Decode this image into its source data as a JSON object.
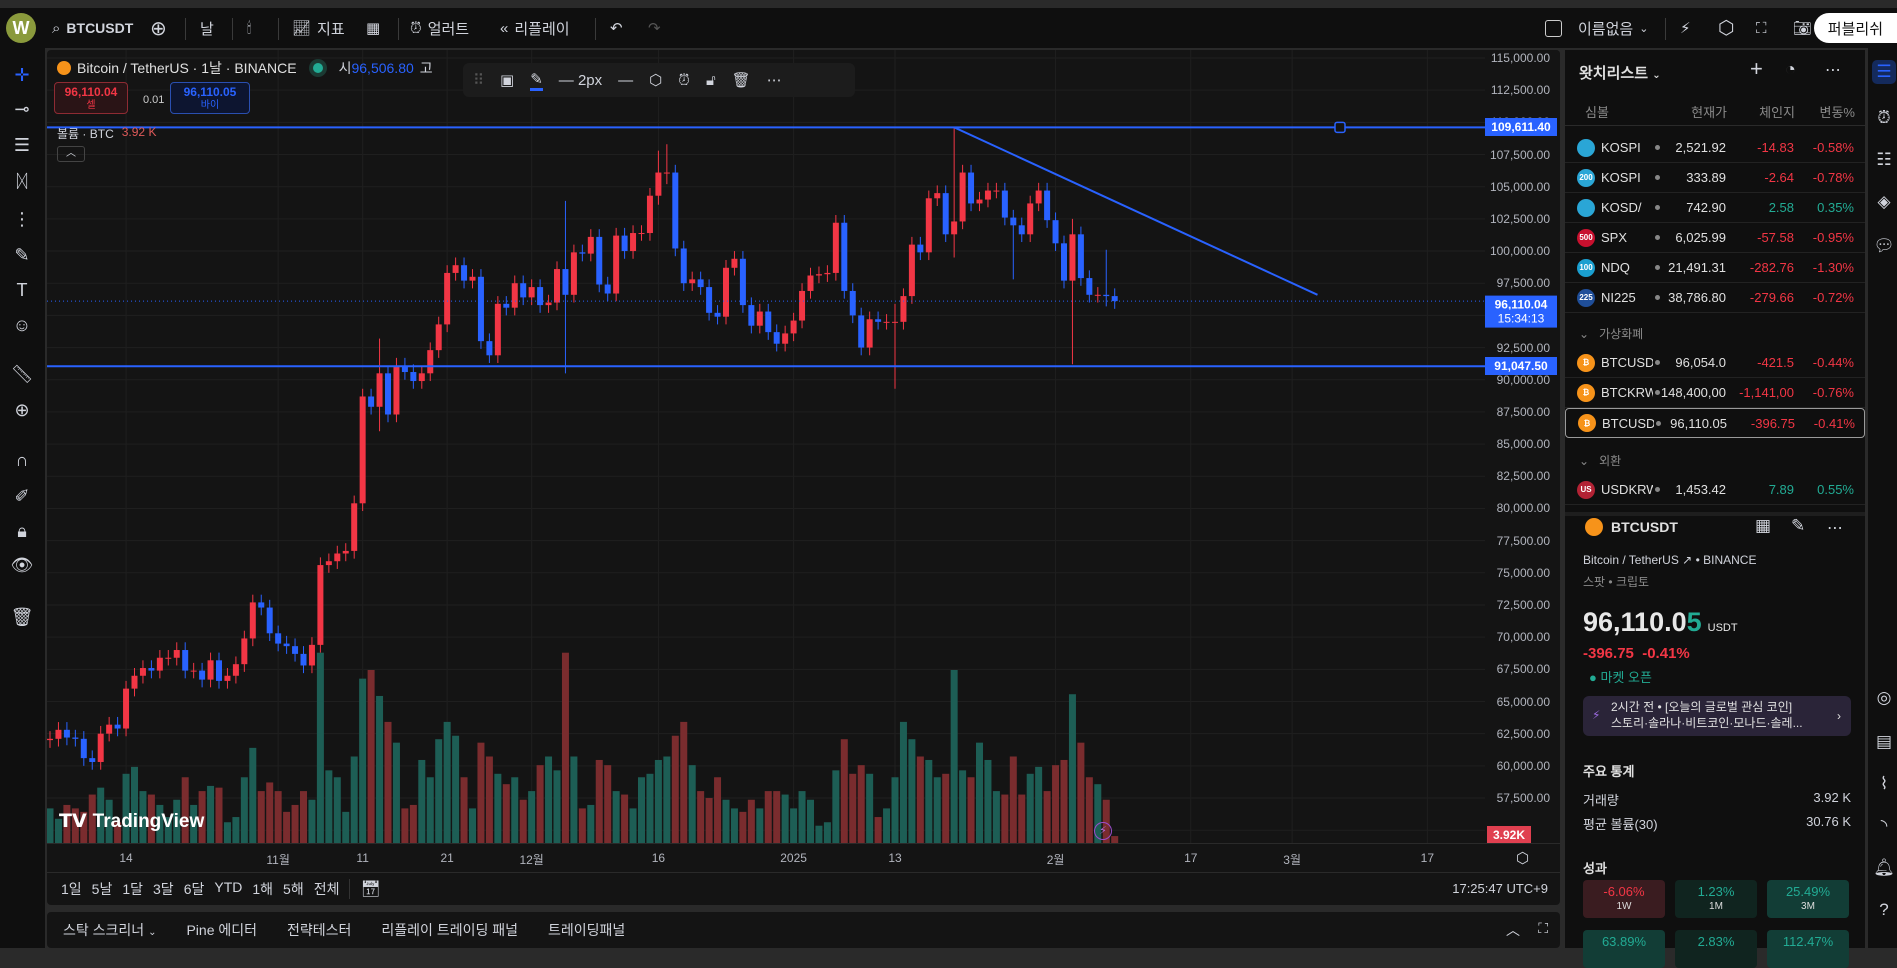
{
  "topbar": {
    "avatar": "W",
    "symbol": "BTCUSDT",
    "interval": "날",
    "indicators": "지표",
    "alert": "얼러트",
    "replay": "리플레이",
    "layout_name": "이름없음",
    "publish": "퍼블리쉬"
  },
  "legend": {
    "title": "Bitcoin / TetherUS · 1날 · BINANCE",
    "open_label": "시",
    "open_value": "96,506.80",
    "high_label": "고",
    "sell_price": "96,110.04",
    "sell_label": "셀",
    "spread": "0.01",
    "buy_price": "96,110.05",
    "buy_label": "바이",
    "volume_label": "볼륨 · BTC",
    "volume_value": "3.92 K"
  },
  "drawing_toolbar": {
    "width_label": "2px"
  },
  "price_axis": {
    "ticks": [
      "115,000.00",
      "112,500.00",
      "110,000.00",
      "107,500.00",
      "105,000.00",
      "102,500.00",
      "100,000.00",
      "97,500.00",
      "95,000.00",
      "92,500.00",
      "90,000.00",
      "87,500.00",
      "85,000.00",
      "82,500.00",
      "80,000.00",
      "77,500.00",
      "75,000.00",
      "72,500.00",
      "70,000.00",
      "67,500.00",
      "65,000.00",
      "62,500.00",
      "60,000.00",
      "57,500.00"
    ],
    "resistance_label": "109,611.40",
    "support_label": "91,047.50",
    "last_price_label": "96,110.04",
    "countdown": "15:34:13",
    "volume_badge": "3.92K"
  },
  "time_axis": {
    "labels": [
      {
        "text": "14",
        "index": 9
      },
      {
        "text": "11월",
        "index": 27
      },
      {
        "text": "11",
        "index": 37
      },
      {
        "text": "21",
        "index": 47
      },
      {
        "text": "12월",
        "index": 57
      },
      {
        "text": "16",
        "index": 72
      },
      {
        "text": "2025",
        "index": 88
      },
      {
        "text": "13",
        "index": 100
      },
      {
        "text": "2월",
        "index": 119
      },
      {
        "text": "17",
        "index": 135
      },
      {
        "text": "3월",
        "index": 147
      },
      {
        "text": "17",
        "index": 163
      }
    ]
  },
  "range_bar": {
    "ranges": [
      "1일",
      "5날",
      "1달",
      "3달",
      "6달",
      "YTD",
      "1해",
      "5해",
      "전체"
    ],
    "clock": "17:25:47 UTC+9"
  },
  "bottom_panel": {
    "tabs": [
      "스탁 스크리너",
      "Pine 에디터",
      "전략테스터",
      "리플레이 트레이딩 패널",
      "트레이딩패널"
    ]
  },
  "watchlist": {
    "title": "왓치리스트",
    "headers": {
      "symbol": "심볼",
      "last": "현재가",
      "change": "체인지",
      "pct": "변동%"
    },
    "rows": [
      {
        "icon": "",
        "color": "#2aa6d6",
        "symbol": "KOSPI",
        "last": "2,521.92",
        "change": "-14.83",
        "pct": "-0.58%",
        "dir": "down"
      },
      {
        "icon": "200",
        "color": "#2aa6d6",
        "symbol": "KOSPI",
        "last": "333.89",
        "change": "-2.64",
        "pct": "-0.78%",
        "dir": "down"
      },
      {
        "icon": "",
        "color": "#2aa6d6",
        "symbol": "KOSD/",
        "last": "742.90",
        "change": "2.58",
        "pct": "0.35%",
        "dir": "up"
      },
      {
        "icon": "500",
        "color": "#c8102e",
        "symbol": "SPX",
        "last": "6,025.99",
        "change": "-57.58",
        "pct": "-0.95%",
        "dir": "down"
      },
      {
        "icon": "100",
        "color": "#1a9fd0",
        "symbol": "NDQ",
        "last": "21,491.31",
        "change": "-282.76",
        "pct": "-1.30%",
        "dir": "down"
      },
      {
        "icon": "225",
        "color": "#1f4e99",
        "symbol": "NI225",
        "last": "38,786.80",
        "change": "-279.66",
        "pct": "-0.72%",
        "dir": "down"
      }
    ],
    "group_crypto": "가상화폐",
    "crypto_rows": [
      {
        "icon": "₿",
        "color": "#f7931a",
        "symbol": "BTCUSD",
        "last": "96,054.0",
        "change": "-421.5",
        "pct": "-0.44%",
        "dir": "down"
      },
      {
        "icon": "₿",
        "color": "#f7931a",
        "symbol": "BTCKRW",
        "last": "148,400,00",
        "change": "-1,141,00",
        "pct": "-0.76%",
        "dir": "down"
      },
      {
        "icon": "₿",
        "color": "#f7931a",
        "symbol": "BTCUSDT",
        "last": "96,110.05",
        "change": "-396.75",
        "pct": "-0.41%",
        "dir": "down"
      }
    ],
    "group_fx": "외환",
    "fx_rows": [
      {
        "icon": "US",
        "color": "#b22234",
        "symbol": "USDKRW",
        "last": "1,453.42",
        "change": "7.89",
        "pct": "0.55%",
        "dir": "up"
      }
    ]
  },
  "details": {
    "symbol": "BTCUSDT",
    "name": "Bitcoin / TetherUS",
    "exchange": "BINANCE",
    "type": "스팟 • 크립토",
    "price_main": "96,110.0",
    "price_last_digit": "5",
    "currency": "USDT",
    "change": "-396.75",
    "change_pct": "-0.41%",
    "market_status": "마켓 오픈",
    "news_time": "2시간 전",
    "news_title": "[오늘의 글로벌 관심 코인]",
    "news_body": "스토리·솔라나·비트코인·모나드·솔레...",
    "stats_title": "주요 통계",
    "stats": [
      {
        "label": "거래량",
        "value": "3.92 K"
      },
      {
        "label": "평균 볼륨(30)",
        "value": "30.76 K"
      }
    ],
    "perf_title": "성과",
    "performance": [
      {
        "value": "-6.06%",
        "period": "1W",
        "dir": "down",
        "bg": "#3a1c20"
      },
      {
        "value": "1.23%",
        "period": "1M",
        "dir": "up",
        "bg": "#10241f"
      },
      {
        "value": "25.49%",
        "period": "3M",
        "dir": "up",
        "bg": "#123d36"
      },
      {
        "value": "63.89%",
        "period": "",
        "dir": "up",
        "bg": "#123d36"
      },
      {
        "value": "2.83%",
        "period": "",
        "dir": "up",
        "bg": "#10241f"
      },
      {
        "value": "112.47%",
        "period": "",
        "dir": "up",
        "bg": "#123d36"
      }
    ]
  },
  "colors": {
    "up": "#f23645",
    "down": "#2962ff",
    "vol_up": "#1d5e55",
    "vol_down": "#7a2c2e",
    "line": "#2962ff"
  },
  "chart_data": {
    "type": "candlestick",
    "unit": "thousand USDT",
    "first_open": 62.0,
    "close": [
      62.1,
      62.8,
      62.2,
      62.1,
      60.6,
      60.3,
      62.5,
      63.2,
      62.9,
      66.0,
      67.0,
      67.6,
      67.4,
      68.4,
      68.4,
      69.0,
      67.4,
      67.4,
      66.7,
      68.2,
      66.6,
      67.0,
      67.9,
      69.9,
      72.7,
      72.3,
      70.3,
      69.5,
      69.3,
      68.7,
      67.8,
      69.4,
      75.6,
      75.9,
      76.5,
      76.7,
      80.4,
      88.7,
      87.9,
      90.5,
      87.3,
      91.1,
      90.6,
      89.9,
      90.5,
      92.3,
      94.3,
      98.3,
      98.9,
      97.7,
      98.0,
      93.0,
      91.9,
      95.9,
      95.6,
      97.5,
      96.4,
      97.2,
      95.8,
      96.0,
      98.6,
      96.6,
      99.9,
      99.8,
      101.1,
      97.4,
      96.7,
      101.2,
      100.0,
      101.4,
      101.4,
      104.3,
      106.1,
      106.1,
      100.2,
      97.5,
      97.8,
      97.2,
      95.2,
      94.9,
      98.7,
      99.4,
      95.8,
      94.2,
      95.3,
      93.7,
      92.8,
      93.6,
      94.6,
      96.9,
      98.1,
      98.2,
      98.3,
      102.2,
      96.9,
      95.0,
      92.5,
      94.7,
      94.5,
      94.5,
      94.5,
      96.5,
      100.5,
      99.9,
      104.1,
      104.5,
      101.3,
      102.3,
      106.1,
      103.7,
      104.0,
      104.7,
      104.7,
      102.6,
      102.0,
      101.3,
      103.7,
      104.7,
      102.4,
      100.6,
      97.7,
      101.3,
      97.9,
      96.6,
      96.6,
      96.5,
      96.11
    ],
    "wick_overrides": [
      {
        "index": 39,
        "high": 93.2,
        "low": 86.0
      },
      {
        "index": 61,
        "high": 103.9,
        "low": 90.5
      },
      {
        "index": 72,
        "high": 107.8,
        "low": 103.6
      },
      {
        "index": 73,
        "high": 108.3,
        "low": 105.2
      },
      {
        "index": 100,
        "high": 95.9,
        "low": 89.3
      },
      {
        "index": 107,
        "high": 109.6,
        "low": 99.5
      },
      {
        "index": 114,
        "high": 103.2,
        "low": 97.8
      },
      {
        "index": 121,
        "high": 102.5,
        "low": 91.2
      },
      {
        "index": 125,
        "high": 100.1,
        "low": 95.7
      }
    ],
    "volume_k": [
      20,
      14,
      22,
      20,
      18,
      28,
      32,
      25,
      12,
      40,
      44,
      30,
      28,
      22,
      15,
      25,
      38,
      22,
      30,
      33,
      32,
      12,
      15,
      38,
      55,
      30,
      35,
      30,
      18,
      22,
      30,
      25,
      110,
      42,
      38,
      18,
      50,
      95,
      100,
      85,
      70,
      58,
      20,
      22,
      48,
      38,
      60,
      70,
      62,
      38,
      20,
      58,
      50,
      40,
      34,
      38,
      25,
      30,
      45,
      50,
      42,
      110,
      50,
      20,
      22,
      48,
      45,
      30,
      28,
      20,
      38,
      40,
      48,
      50,
      62,
      70,
      45,
      30,
      26,
      38,
      25,
      20,
      18,
      25,
      20,
      30,
      30,
      28,
      20,
      30,
      25,
      10,
      12,
      42,
      60,
      40,
      45,
      40,
      15,
      20,
      38,
      70,
      60,
      50,
      48,
      38,
      40,
      100,
      42,
      38,
      58,
      48,
      30,
      28,
      50,
      28,
      40,
      44,
      30,
      45,
      48,
      86,
      58,
      38,
      34,
      25,
      4
    ],
    "price_range": [
      55000,
      115000
    ],
    "horizontal_lines": [
      109611.4,
      91047.5
    ],
    "trendline": {
      "from": {
        "index": 107,
        "price": 109611.4
      },
      "to": {
        "index": 150,
        "price": 96600
      }
    },
    "last_price": 96110.04
  }
}
